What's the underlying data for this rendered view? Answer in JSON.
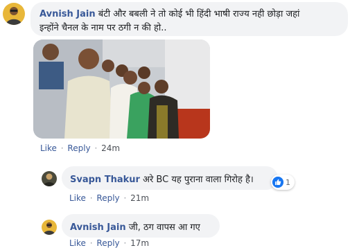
{
  "comments": [
    {
      "author": "Avnish Jain",
      "text_line1": "बंटी और बबली ने तो कोई भी हिंदी भाषी राज्य नही छोड़ा जहां",
      "text_line2": "इन्होंने चैनल के नाम पर ठगी न की हो..",
      "actions": {
        "like": "Like",
        "reply": "Reply",
        "time": "24m"
      },
      "has_photo": true
    },
    {
      "author": "Svapn Thakur",
      "text": "अरे BC यह पुराना वाला गिरोह है।",
      "reactions": {
        "count": "1",
        "icon": "thumbs-up-icon"
      },
      "actions": {
        "like": "Like",
        "reply": "Reply",
        "time": "21m"
      }
    },
    {
      "author": "Avnish Jain",
      "text": "जी, ठग वापस आ गए",
      "actions": {
        "like": "Like",
        "reply": "Reply",
        "time": "17m"
      }
    }
  ],
  "separator": "·",
  "colors": {
    "author": "#385898",
    "bubble": "#f2f3f5",
    "text": "#1c1e21",
    "meta": "#90949c",
    "like_blue": "#1877f2"
  }
}
